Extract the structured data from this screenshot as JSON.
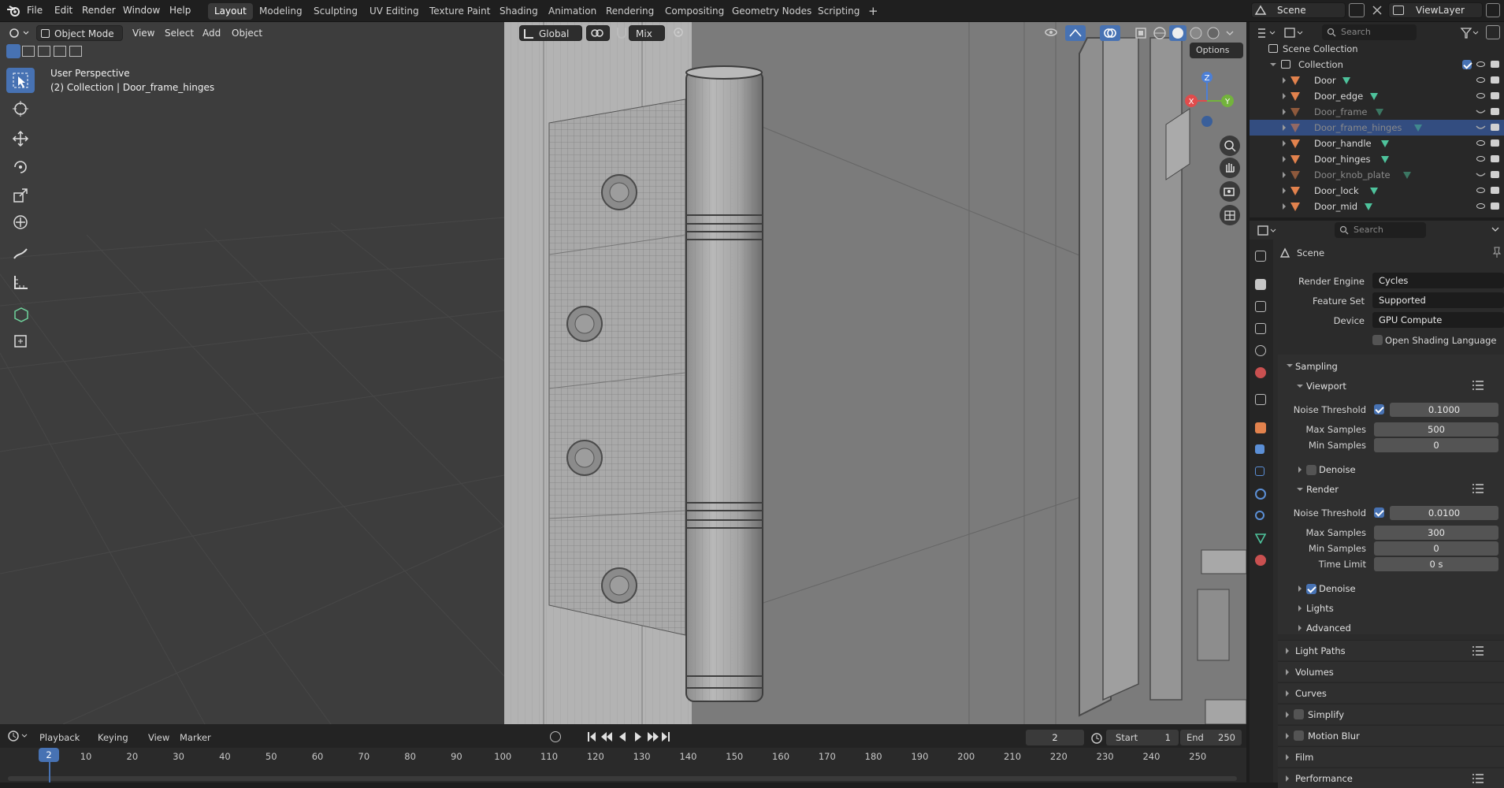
{
  "topbar": {
    "menus": [
      "File",
      "Edit",
      "Render",
      "Window",
      "Help"
    ],
    "workspaces": [
      "Layout",
      "Modeling",
      "Sculpting",
      "UV Editing",
      "Texture Paint",
      "Shading",
      "Animation",
      "Rendering",
      "Compositing",
      "Geometry Nodes",
      "Scripting"
    ],
    "active_workspace": "Layout",
    "add_tab": "+",
    "scene": "Scene",
    "view_layer": "ViewLayer"
  },
  "viewport_header": {
    "mode": "Object Mode",
    "menus": [
      "View",
      "Select",
      "Add",
      "Object"
    ],
    "orientation": "Global",
    "snap_mode": "Mix",
    "options": "Options"
  },
  "viewport": {
    "perspective": "User Perspective",
    "context": "(2) Collection | Door_frame_hinges",
    "gizmo": {
      "x": "X",
      "y": "Y",
      "z": "Z"
    }
  },
  "outliner": {
    "search_placeholder": "Search",
    "scene_collection": "Scene Collection",
    "collection": "Collection",
    "items": [
      {
        "name": "Door",
        "dim": false,
        "selected": false,
        "visible": true
      },
      {
        "name": "Door_edge",
        "dim": false,
        "selected": false,
        "visible": true
      },
      {
        "name": "Door_frame",
        "dim": true,
        "selected": false,
        "visible": false
      },
      {
        "name": "Door_frame_hinges",
        "dim": true,
        "selected": true,
        "visible": false
      },
      {
        "name": "Door_handle",
        "dim": false,
        "selected": false,
        "visible": true
      },
      {
        "name": "Door_hinges",
        "dim": false,
        "selected": false,
        "visible": true
      },
      {
        "name": "Door_knob_plate",
        "dim": true,
        "selected": false,
        "visible": false
      },
      {
        "name": "Door_lock",
        "dim": false,
        "selected": false,
        "visible": true
      },
      {
        "name": "Door_mid",
        "dim": false,
        "selected": false,
        "visible": true
      }
    ]
  },
  "properties": {
    "search_placeholder": "Search",
    "scene_label": "Scene",
    "render_engine": {
      "label": "Render Engine",
      "value": "Cycles"
    },
    "feature_set": {
      "label": "Feature Set",
      "value": "Supported"
    },
    "device": {
      "label": "Device",
      "value": "GPU Compute"
    },
    "osl": {
      "label": "Open Shading Language",
      "checked": false
    },
    "sampling": {
      "title": "Sampling",
      "viewport": {
        "title": "Viewport",
        "noise_threshold": {
          "label": "Noise Threshold",
          "value": "0.1000",
          "checked": true
        },
        "max_samples": {
          "label": "Max Samples",
          "value": "500"
        },
        "min_samples": {
          "label": "Min Samples",
          "value": "0"
        },
        "denoise": {
          "label": "Denoise",
          "checked": false
        }
      },
      "render": {
        "title": "Render",
        "noise_threshold": {
          "label": "Noise Threshold",
          "value": "0.0100",
          "checked": true
        },
        "max_samples": {
          "label": "Max Samples",
          "value": "300"
        },
        "min_samples": {
          "label": "Min Samples",
          "value": "0"
        },
        "time_limit": {
          "label": "Time Limit",
          "value": "0 s"
        },
        "denoise": {
          "label": "Denoise",
          "checked": true
        }
      },
      "lights": "Lights",
      "advanced": "Advanced"
    },
    "panels": [
      "Light Paths",
      "Volumes",
      "Curves",
      "Simplify",
      "Motion Blur",
      "Film",
      "Performance"
    ]
  },
  "timeline": {
    "menus": [
      "Playback",
      "Keying",
      "View",
      "Marker"
    ],
    "current_frame": "2",
    "start_label": "Start",
    "start": "1",
    "end_label": "End",
    "end": "250",
    "ticks": [
      "10",
      "20",
      "30",
      "40",
      "50",
      "60",
      "70",
      "80",
      "90",
      "100",
      "110",
      "120",
      "130",
      "140",
      "150",
      "160",
      "170",
      "180",
      "190",
      "200",
      "210",
      "220",
      "230",
      "240",
      "250"
    ],
    "playhead": "2"
  },
  "colors": {
    "accent": "#4772b3",
    "object_orange": "#e2824d",
    "mesh_green": "#4ec39c",
    "selection": "#334d80"
  }
}
